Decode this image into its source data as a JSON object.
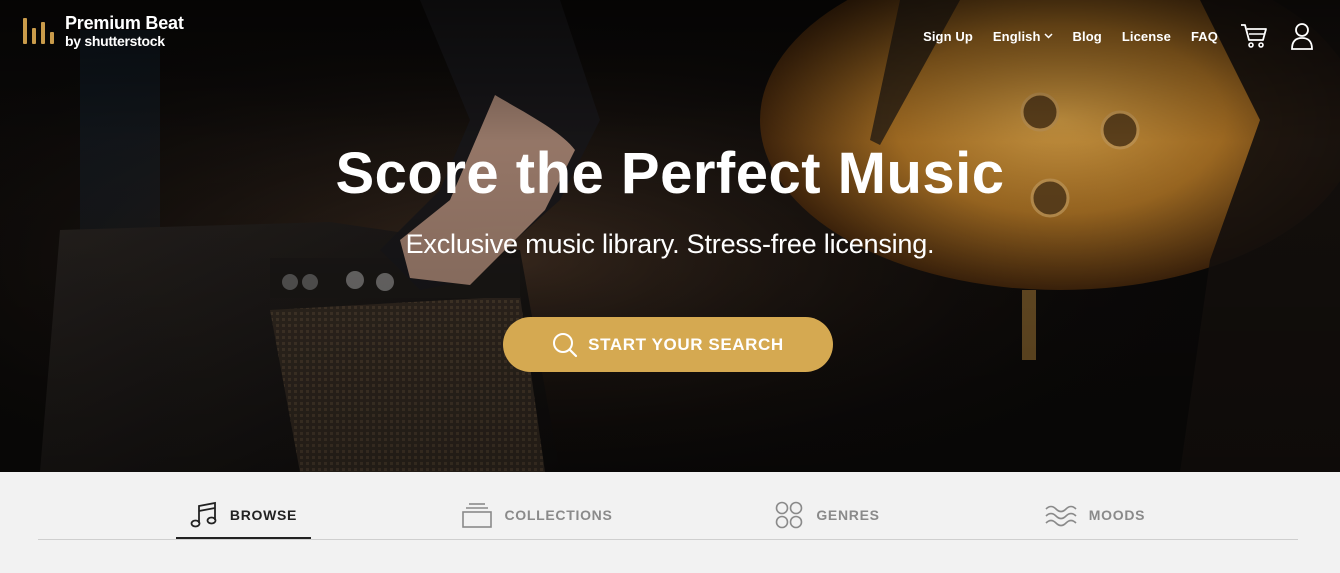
{
  "brand": {
    "name": "Premium Beat",
    "tagline": "by shutterstock",
    "accent": "#c99b4a"
  },
  "nav": {
    "links": [
      {
        "label": "Sign Up"
      },
      {
        "label": "English"
      },
      {
        "label": "Blog"
      },
      {
        "label": "License"
      },
      {
        "label": "FAQ"
      }
    ],
    "icons": [
      "cart-icon",
      "user-icon"
    ]
  },
  "hero": {
    "title": "Score the Perfect Music",
    "subtitle": "Exclusive music library. Stress-free licensing.",
    "cta": {
      "label": "START YOUR SEARCH",
      "icon": "search-icon",
      "color": "#d5a951"
    }
  },
  "tabs": [
    {
      "label": "BROWSE",
      "icon": "music-note-icon",
      "active": true
    },
    {
      "label": "COLLECTIONS",
      "icon": "collections-icon",
      "active": false
    },
    {
      "label": "GENRES",
      "icon": "genres-icon",
      "active": false
    },
    {
      "label": "MOODS",
      "icon": "moods-icon",
      "active": false
    }
  ]
}
